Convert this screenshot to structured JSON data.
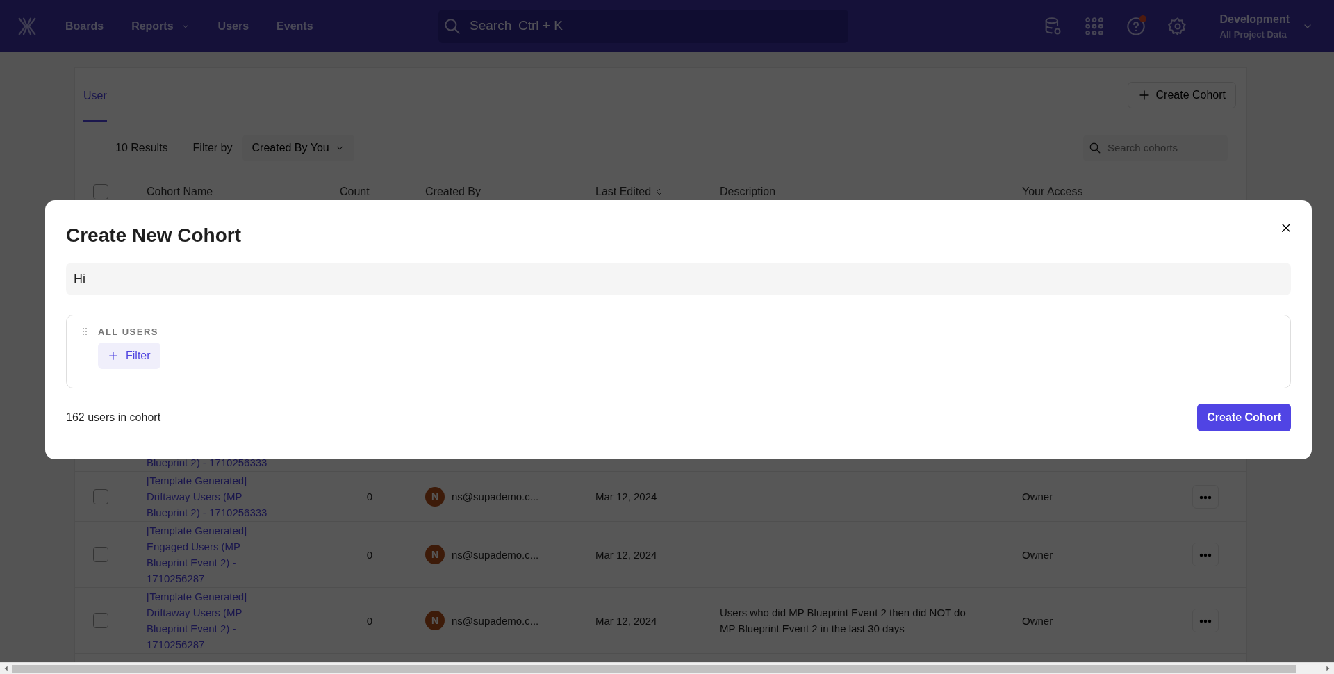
{
  "nav": {
    "items": [
      {
        "label": "Boards",
        "caret": false
      },
      {
        "label": "Reports",
        "caret": true
      },
      {
        "label": "Users",
        "caret": false
      },
      {
        "label": "Events",
        "caret": false
      }
    ],
    "search": {
      "placeholder": "Search",
      "shortcut": "Ctrl + K"
    },
    "help_notification": true,
    "project": {
      "name": "Development",
      "subtitle": "All Project Data"
    }
  },
  "page": {
    "tabs": [
      {
        "label": "User",
        "selected": true
      }
    ],
    "create_button": "Create Cohort",
    "results": "10 Results",
    "filter_label": "Filter by",
    "filter_value": "Created By You",
    "search_placeholder": "Search cohorts",
    "select_all_checked": false,
    "columns": [
      {
        "label": "Cohort Name",
        "sortable": false
      },
      {
        "label": "Count",
        "sortable": false
      },
      {
        "label": "Created By",
        "sortable": false
      },
      {
        "label": "Last Edited",
        "sortable": true
      },
      {
        "label": "Description",
        "sortable": false
      },
      {
        "label": "Your Access",
        "sortable": false
      }
    ],
    "partial_row_name": "Blueprint 2) - 1710256333",
    "rows": [
      {
        "name": "[Template Generated] Driftaway Users (MP Blueprint 2) - 1710256333",
        "count": "0",
        "avatar": "N",
        "created_by": "ns@supademo.c...",
        "last_edited": "Mar 12, 2024",
        "description": "",
        "access": "Owner",
        "checked": false
      },
      {
        "name": "[Template Generated] Engaged Users (MP Blueprint Event 2) - 1710256287",
        "count": "0",
        "avatar": "N",
        "created_by": "ns@supademo.c...",
        "last_edited": "Mar 12, 2024",
        "description": "",
        "access": "Owner",
        "checked": false
      },
      {
        "name": "[Template Generated] Driftaway Users (MP Blueprint Event 2) - 1710256287",
        "count": "0",
        "avatar": "N",
        "created_by": "ns@supademo.c...",
        "last_edited": "Mar 12, 2024",
        "description": "Users who did MP Blueprint Event 2 then did NOT do MP Blueprint Event 2 in the last 30 days",
        "access": "Owner",
        "checked": false
      }
    ]
  },
  "modal": {
    "title": "Create New Cohort",
    "name_value": "Hi",
    "group_label": "ALL USERS",
    "filter_button": "Filter",
    "summary": "162 users in cohort",
    "submit": "Create Cohort"
  }
}
